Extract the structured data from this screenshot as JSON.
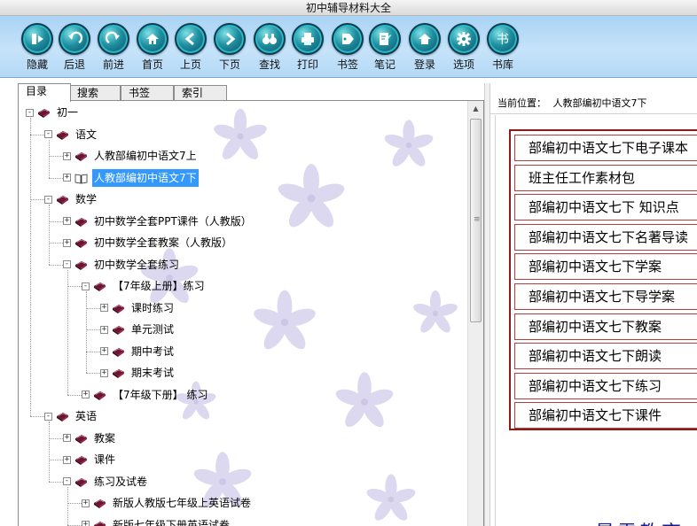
{
  "window": {
    "title": "初中辅导材料大全"
  },
  "toolbar": {
    "buttons": [
      {
        "label": "隐藏",
        "icon": "hide-icon"
      },
      {
        "label": "后退",
        "icon": "back-icon"
      },
      {
        "label": "前进",
        "icon": "forward-icon"
      },
      {
        "label": "首页",
        "icon": "home-icon"
      },
      {
        "label": "上页",
        "icon": "prev-page-icon"
      },
      {
        "label": "下页",
        "icon": "next-page-icon"
      },
      {
        "label": "查找",
        "icon": "binoculars-icon"
      },
      {
        "label": "打印",
        "icon": "printer-icon"
      },
      {
        "label": "书签",
        "icon": "bookmark-icon"
      },
      {
        "label": "笔记",
        "icon": "note-icon"
      },
      {
        "label": "登录",
        "icon": "login-home-icon"
      },
      {
        "label": "选项",
        "icon": "gear-icon"
      },
      {
        "label": "书库",
        "icon": "library-icon"
      }
    ]
  },
  "tabs": {
    "contents": "目录",
    "search": "搜索",
    "bookmarks": "书签",
    "index": "索引"
  },
  "tree": {
    "nodes": [
      {
        "label": "初一",
        "expander": "-"
      },
      {
        "label": "语文",
        "expander": "-"
      },
      {
        "label": "人教部编初中语文7上",
        "expander": "+"
      },
      {
        "label": "人教部编初中语文7下",
        "expander": "+",
        "selected": true
      },
      {
        "label": "数学",
        "expander": "-"
      },
      {
        "label": "初中数学全套PPT课件（人教版）",
        "expander": "+"
      },
      {
        "label": "初中数学全套教案（人教版）",
        "expander": "+"
      },
      {
        "label": "初中数学全套练习",
        "expander": "-"
      },
      {
        "label": "【7年级上册】练习",
        "expander": "-"
      },
      {
        "label": "课时练习",
        "expander": "+"
      },
      {
        "label": "单元测试",
        "expander": "+"
      },
      {
        "label": "期中考试",
        "expander": "+"
      },
      {
        "label": "期末考试",
        "expander": "+"
      },
      {
        "label": "【7年级下册】 练习",
        "expander": "+"
      },
      {
        "label": "英语",
        "expander": "-"
      },
      {
        "label": "教案",
        "expander": "+"
      },
      {
        "label": "课件",
        "expander": "+"
      },
      {
        "label": "练习及试卷",
        "expander": "-"
      },
      {
        "label": "新版人教版七年级上英语试卷",
        "expander": "+"
      },
      {
        "label": "新版七年级下册英语试卷",
        "expander": "+"
      }
    ]
  },
  "location": {
    "label": "当前位置：",
    "value": "人教部编初中语文7下"
  },
  "content_list": [
    "部编初中语文七下电子课本",
    "班主任工作素材包",
    "部编初中语文七下 知识点",
    "部编初中语文七下名著导读",
    "部编初中语文七下学案",
    "部编初中语文七下导学案",
    "部编初中语文七下教案",
    "部编初中语文七下朗读",
    "部编初中语文七下练习",
    "部编初中语文七下课件"
  ],
  "watermark": "最需教育",
  "colors": {
    "toolbar_bg": "#b4d9f6",
    "selection": "#3399ff",
    "list_border": "#8b1a1a"
  }
}
